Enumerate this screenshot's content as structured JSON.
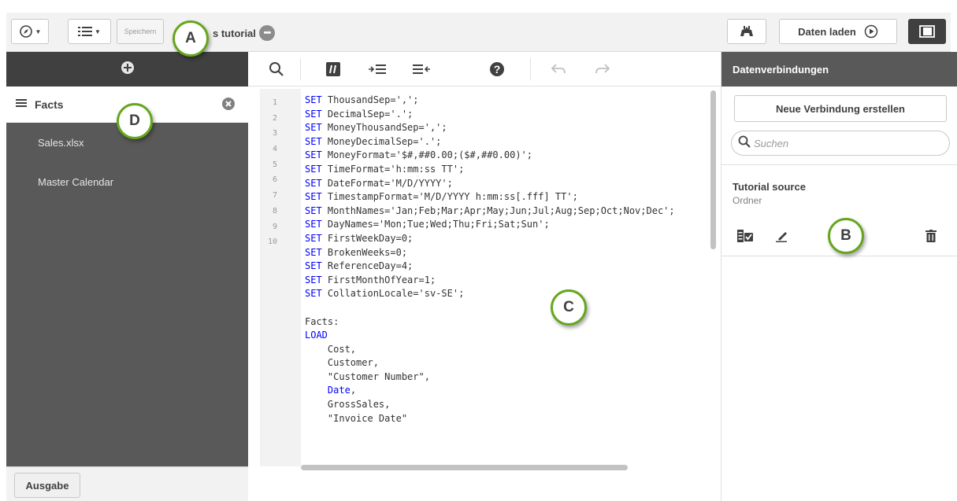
{
  "toolbar": {
    "save_label": "Speichern",
    "app_title": "s tutorial",
    "load_label": "Daten laden"
  },
  "left_panel": {
    "active_tab": "Facts",
    "items": [
      "Sales.xlsx",
      "Master Calendar"
    ],
    "output_label": "Ausgabe"
  },
  "editor": {
    "line_numbers": [
      "1",
      "2",
      "3",
      "4",
      "5",
      "6",
      "7",
      "8",
      "9",
      "10"
    ],
    "code_lines": [
      {
        "kw": "SET",
        "text": " ThousandSep=',';"
      },
      {
        "kw": "SET",
        "text": " DecimalSep='.';"
      },
      {
        "kw": "SET",
        "text": " MoneyThousandSep=',';"
      },
      {
        "kw": "SET",
        "text": " MoneyDecimalSep='.';"
      },
      {
        "kw": "SET",
        "text": " MoneyFormat='$#,##0.00;($#,##0.00)';"
      },
      {
        "kw": "SET",
        "text": " TimeFormat='h:mm:ss TT';"
      },
      {
        "kw": "SET",
        "text": " DateFormat='M/D/YYYY';"
      },
      {
        "kw": "SET",
        "text": " TimestampFormat='M/D/YYYY h:mm:ss[.fff] TT';"
      },
      {
        "kw": "SET",
        "text": " MonthNames='Jan;Feb;Mar;Apr;May;Jun;Jul;Aug;Sep;Oct;Nov;Dec';"
      },
      {
        "kw": "SET",
        "text": " DayNames='Mon;Tue;Wed;Thu;Fri;Sat;Sun';"
      },
      {
        "kw": "SET",
        "text": " FirstWeekDay=0;"
      },
      {
        "kw": "SET",
        "text": " BrokenWeeks=0;"
      },
      {
        "kw": "SET",
        "text": " ReferenceDay=4;"
      },
      {
        "kw": "SET",
        "text": " FirstMonthOfYear=1;"
      },
      {
        "kw": "SET",
        "text": " CollationLocale='sv-SE';"
      },
      {
        "kw": "",
        "text": ""
      },
      {
        "kw": "",
        "text": "Facts:"
      },
      {
        "kw": "LOAD",
        "text": ""
      },
      {
        "kw": "",
        "text": "    Cost,"
      },
      {
        "kw": "",
        "text": "    Customer,"
      },
      {
        "kw": "",
        "text": "    \"Customer Number\","
      },
      {
        "kw": "",
        "text": "    ",
        "kw2": "Date",
        "text2": ","
      },
      {
        "kw": "",
        "text": "    GrossSales,"
      },
      {
        "kw": "",
        "text": "    \"Invoice Date\""
      }
    ]
  },
  "right_panel": {
    "title": "Datenverbindungen",
    "new_connection_label": "Neue Verbindung erstellen",
    "search_placeholder": "Suchen",
    "connection_name": "Tutorial source",
    "connection_type": "Ordner"
  },
  "markers": {
    "a": "A",
    "b": "B",
    "c": "C",
    "d": "D"
  },
  "colors": {
    "keyword": "#0000ff",
    "marker_ring": "#66a61e",
    "panel_dark": "#595959"
  }
}
